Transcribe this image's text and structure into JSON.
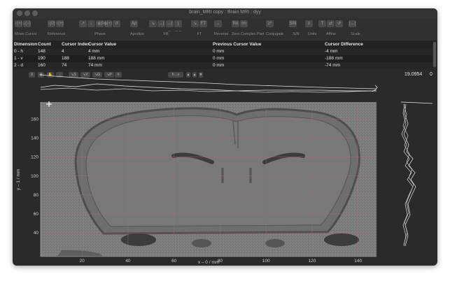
{
  "window": {
    "title": "brain_MRI copy : Brain MRI : dyy"
  },
  "toolbar": {
    "groups": [
      {
        "label": "Move Cursor",
        "buttons": [
          "↑(+)",
          "↓(−)"
        ]
      },
      {
        "label": "Reference",
        "buttons": [
          "↕(0)",
          "↕(+)"
        ]
      },
      {
        "label": "Phase",
        "buttons": [
          "↗",
          "↓",
          "↑ϕ(0)",
          "ϕ(+)",
          "↺"
        ]
      },
      {
        "label": "Apodize",
        "buttons": [
          "Ap"
        ]
      },
      {
        "label": "Fill",
        "buttons": [
          "↘",
          "→|",
          "→|←",
          "|→←"
        ]
      },
      {
        "label": "FT",
        "buttons": [
          "↘",
          "FT"
        ]
      },
      {
        "label": "Reverse",
        "buttons": [
          "↔"
        ]
      },
      {
        "label": "Zero Complex Part",
        "buttons": [
          "Re",
          "Im"
        ]
      },
      {
        "label": "Conjugate",
        "buttons": [
          "z*"
        ]
      },
      {
        "label": "S/N",
        "buttons": [
          "S/N"
        ]
      },
      {
        "label": "Units",
        "buttons": [
          "≡"
        ]
      },
      {
        "label": "Affine",
        "buttons": [
          "T",
          "⇄",
          "↺"
        ]
      },
      {
        "label": "Scale",
        "buttons": [
          "|↔|"
        ]
      }
    ]
  },
  "table": {
    "headers": [
      "Dimension",
      "Count",
      "Cursor Index",
      "Cursor Value",
      "Previous Cursor Value",
      "Cursor Difference"
    ],
    "rows": [
      [
        "0 - h",
        "148",
        "4",
        "4 mm",
        "0 mm",
        "-4 mm"
      ],
      [
        "1 - v",
        "190",
        "188",
        "188 mm",
        "0 mm",
        "-188 mm"
      ],
      [
        "2 - d",
        "160",
        "74",
        "74 mm",
        "0 mm",
        "-74 mm"
      ]
    ]
  },
  "controls": {
    "buttons": [
      "0",
      "◉",
      "✋",
      "→",
      "↘S",
      "↘V",
      "↘G",
      "↘P",
      "#"
    ],
    "dropdown": "h→v",
    "value": "19.0954",
    "zero": "0"
  },
  "plot": {
    "xlabel": "x – 0 / mm",
    "ylabel": "y – 1 / mm",
    "xticks": [
      "20",
      "40",
      "60",
      "80",
      "100",
      "120",
      "140"
    ],
    "yticks": [
      "40",
      "60",
      "80",
      "100",
      "120",
      "140",
      "160"
    ]
  }
}
